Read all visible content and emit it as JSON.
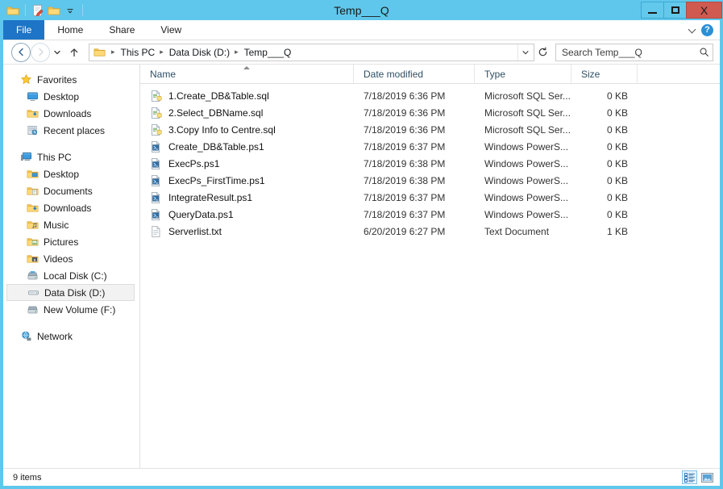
{
  "window": {
    "title": "Temp___Q",
    "controls": {
      "minimize": "Minimize",
      "maximize": "Maximize",
      "close": "X"
    },
    "accent_color": "#5fc7ec",
    "close_color": "#d05a50"
  },
  "quick_access": [
    {
      "name": "folder-icon",
      "label": "Folder"
    },
    {
      "name": "properties-icon",
      "label": "Properties"
    },
    {
      "name": "new-folder-icon",
      "label": "New folder"
    },
    {
      "name": "chevron-down-icon",
      "label": "Customize Quick Access Toolbar"
    }
  ],
  "ribbon": {
    "tabs": [
      {
        "label": "File",
        "active": true
      },
      {
        "label": "Home",
        "active": false
      },
      {
        "label": "Share",
        "active": false
      },
      {
        "label": "View",
        "active": false
      }
    ],
    "expand_label": "Expand the Ribbon",
    "help_label": "?"
  },
  "address": {
    "back_label": "Back",
    "forward_label": "Forward",
    "recent_label": "Recent locations",
    "up_label": "Up",
    "breadcrumb": [
      "This PC",
      "Data Disk (D:)",
      "Temp___Q"
    ],
    "separator": "▸",
    "dropdown_label": "Previous locations",
    "refresh_label": "↻"
  },
  "search": {
    "placeholder": "Search Temp___Q",
    "icon": "search-icon"
  },
  "navpane": {
    "groups": [
      {
        "name": "favorites",
        "header": {
          "label": "Favorites",
          "icon": "star-icon"
        },
        "items": [
          {
            "label": "Desktop",
            "icon": "desktop-icon"
          },
          {
            "label": "Downloads",
            "icon": "downloads-folder-icon"
          },
          {
            "label": "Recent places",
            "icon": "recent-places-icon"
          }
        ]
      },
      {
        "name": "this-pc",
        "header": {
          "label": "This PC",
          "icon": "computer-icon"
        },
        "items": [
          {
            "label": "Desktop",
            "icon": "desktop-folder-icon",
            "selected": false
          },
          {
            "label": "Documents",
            "icon": "documents-folder-icon",
            "selected": false
          },
          {
            "label": "Downloads",
            "icon": "downloads-folder-icon",
            "selected": false
          },
          {
            "label": "Music",
            "icon": "music-folder-icon",
            "selected": false
          },
          {
            "label": "Pictures",
            "icon": "pictures-folder-icon",
            "selected": false
          },
          {
            "label": "Videos",
            "icon": "videos-folder-icon",
            "selected": false
          },
          {
            "label": "Local Disk (C:)",
            "icon": "system-drive-icon",
            "selected": false
          },
          {
            "label": "Data Disk (D:)",
            "icon": "drive-icon",
            "selected": true
          },
          {
            "label": "New Volume (F:)",
            "icon": "drive-icon",
            "selected": false
          }
        ]
      },
      {
        "name": "network",
        "header": {
          "label": "Network",
          "icon": "network-icon"
        },
        "items": []
      }
    ]
  },
  "filelist": {
    "columns": [
      {
        "key": "name",
        "label": "Name",
        "sorted": "asc"
      },
      {
        "key": "date",
        "label": "Date modified",
        "sorted": null
      },
      {
        "key": "type",
        "label": "Type",
        "sorted": null
      },
      {
        "key": "size",
        "label": "Size",
        "sorted": null
      }
    ],
    "rows": [
      {
        "name": "1.Create_DB&Table.sql",
        "date": "7/18/2019 6:36 PM",
        "type": "Microsoft SQL Ser...",
        "size": "0 KB",
        "icon": "sql-file-icon"
      },
      {
        "name": "2.Select_DBName.sql",
        "date": "7/18/2019 6:36 PM",
        "type": "Microsoft SQL Ser...",
        "size": "0 KB",
        "icon": "sql-file-icon"
      },
      {
        "name": "3.Copy Info to Centre.sql",
        "date": "7/18/2019 6:36 PM",
        "type": "Microsoft SQL Ser...",
        "size": "0 KB",
        "icon": "sql-file-icon"
      },
      {
        "name": "Create_DB&Table.ps1",
        "date": "7/18/2019 6:37 PM",
        "type": "Windows PowerS...",
        "size": "0 KB",
        "icon": "powershell-file-icon"
      },
      {
        "name": "ExecPs.ps1",
        "date": "7/18/2019 6:38 PM",
        "type": "Windows PowerS...",
        "size": "0 KB",
        "icon": "powershell-file-icon"
      },
      {
        "name": "ExecPs_FirstTime.ps1",
        "date": "7/18/2019 6:38 PM",
        "type": "Windows PowerS...",
        "size": "0 KB",
        "icon": "powershell-file-icon"
      },
      {
        "name": "IntegrateResult.ps1",
        "date": "7/18/2019 6:37 PM",
        "type": "Windows PowerS...",
        "size": "0 KB",
        "icon": "powershell-file-icon"
      },
      {
        "name": "QueryData.ps1",
        "date": "7/18/2019 6:37 PM",
        "type": "Windows PowerS...",
        "size": "0 KB",
        "icon": "powershell-file-icon"
      },
      {
        "name": "Serverlist.txt",
        "date": "6/20/2019 6:27 PM",
        "type": "Text Document",
        "size": "1 KB",
        "icon": "text-file-icon"
      }
    ]
  },
  "status": {
    "item_count": "9 items",
    "views": [
      {
        "name": "details-view-button",
        "label": "Details view",
        "active": true
      },
      {
        "name": "large-icons-view-button",
        "label": "Large icons view",
        "active": false
      }
    ]
  }
}
